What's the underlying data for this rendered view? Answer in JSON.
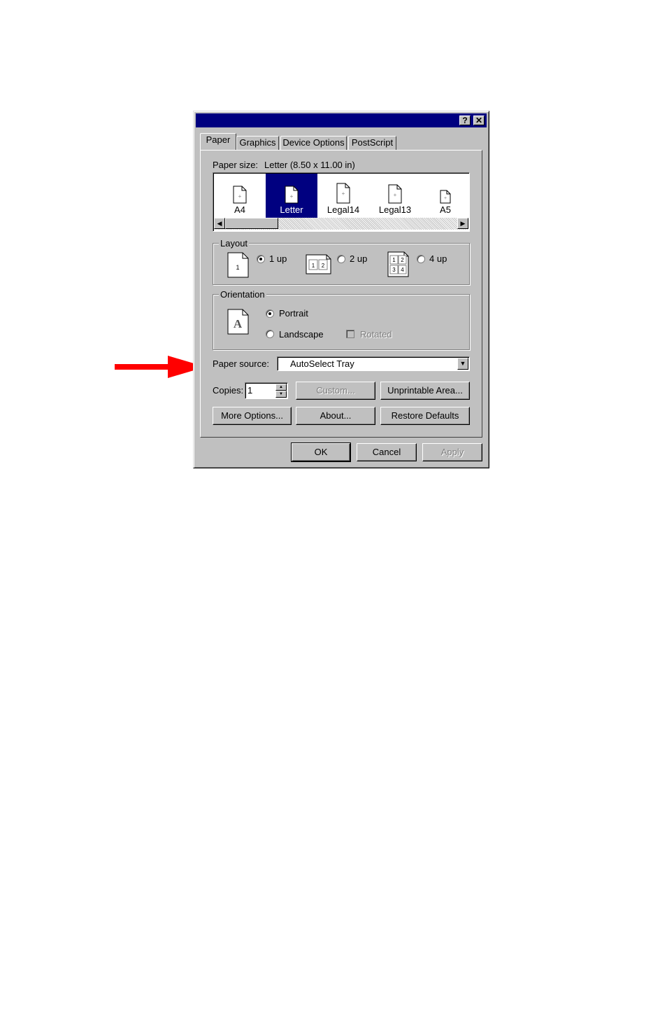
{
  "dialog": {
    "title_buttons": {
      "help": "?",
      "close": "✕"
    },
    "tabs": [
      {
        "label": "Paper",
        "active": true
      },
      {
        "label": "Graphics"
      },
      {
        "label": "Device Options"
      },
      {
        "label": "PostScript"
      }
    ],
    "paper_size": {
      "label": "Paper size:",
      "value": "Letter (8.50 x 11.00 in)",
      "items": [
        {
          "label": "A4"
        },
        {
          "label": "Letter",
          "selected": true
        },
        {
          "label": "Legal14"
        },
        {
          "label": "Legal13"
        },
        {
          "label": "A5"
        }
      ]
    },
    "layout": {
      "label": "Layout",
      "options": [
        {
          "label": "1 up",
          "selected": true,
          "icon_text": [
            "1"
          ]
        },
        {
          "label": "2 up",
          "icon_text": [
            "1",
            "2"
          ]
        },
        {
          "label": "4 up",
          "icon_text": [
            "1",
            "2",
            "3",
            "4"
          ]
        }
      ]
    },
    "orientation": {
      "label": "Orientation",
      "icon_letter": "A",
      "portrait": "Portrait",
      "landscape": "Landscape",
      "rotated": "Rotated"
    },
    "paper_source": {
      "label": "Paper source:",
      "value": "AutoSelect Tray"
    },
    "copies": {
      "label": "Copies:",
      "value": "1"
    },
    "buttons": {
      "custom": "Custom...",
      "unprintable": "Unprintable Area...",
      "more_options": "More Options...",
      "about": "About...",
      "restore": "Restore Defaults",
      "ok": "OK",
      "cancel": "Cancel",
      "apply": "Apply"
    }
  },
  "annotation": {
    "arrow_color": "#ff0000"
  },
  "colors": {
    "titlebar": "#000080",
    "face": "#c0c0c0",
    "selection": "#000080"
  }
}
